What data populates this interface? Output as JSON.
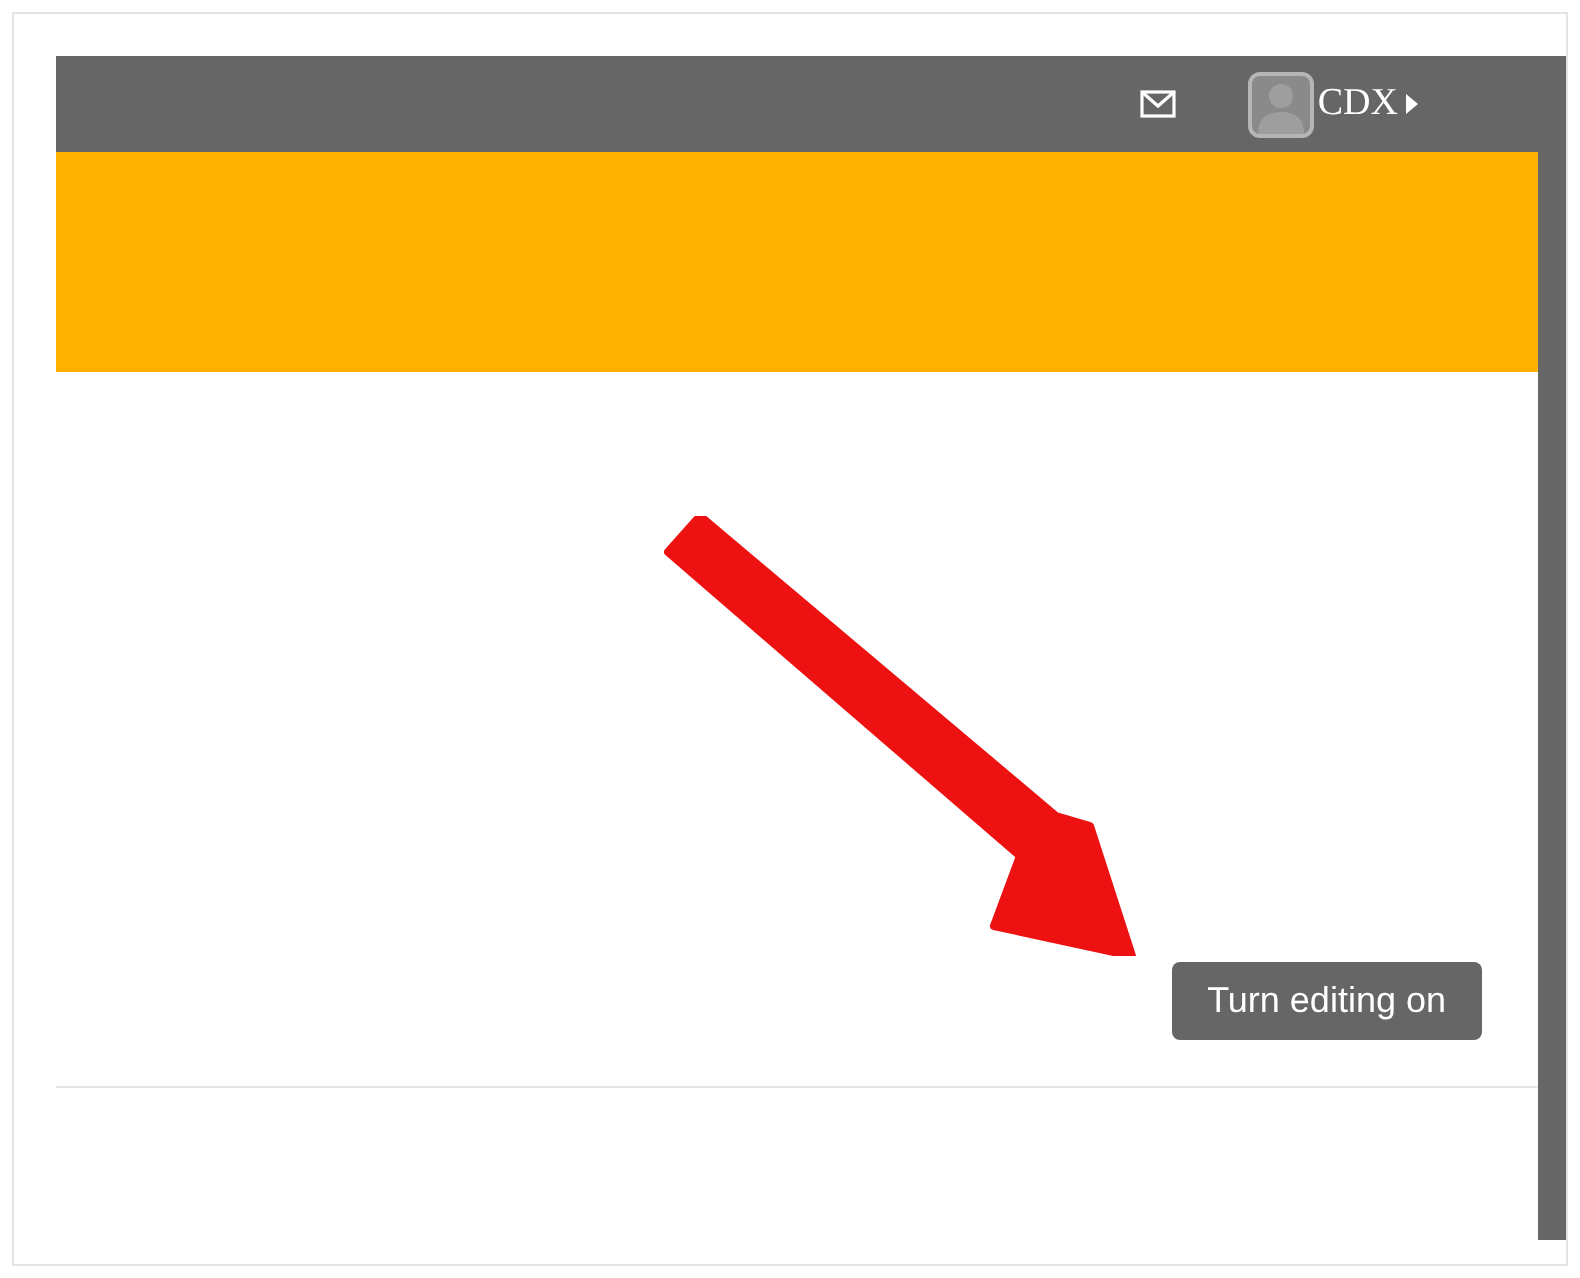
{
  "top_bar": {
    "user_name": "CDX"
  },
  "edit_button": {
    "label": "Turn editing on"
  }
}
